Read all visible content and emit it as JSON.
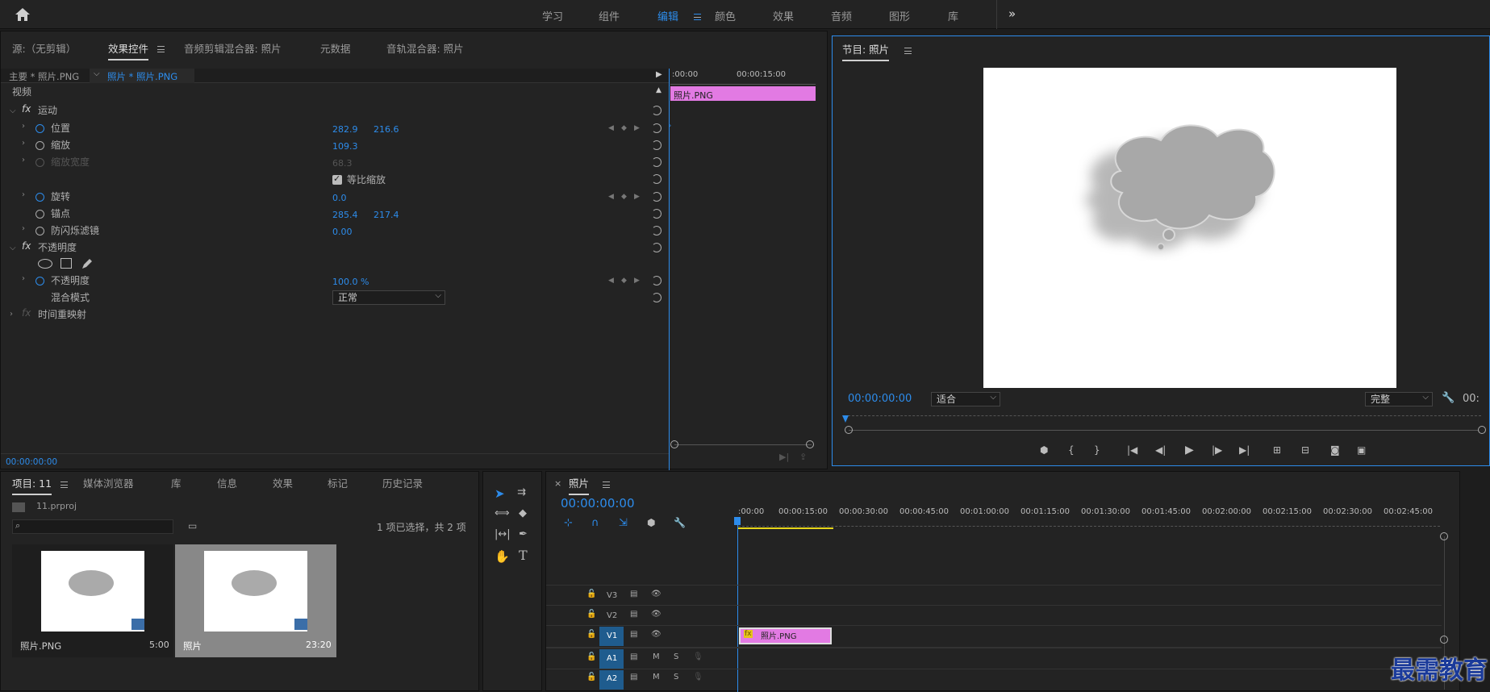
{
  "colors": {
    "accent": "#2d8ceb",
    "clip_pink": "#e27ae3",
    "panel_bg": "#232323",
    "bg": "#1d1d1d"
  },
  "workspaces": [
    "学习",
    "组件",
    "编辑",
    "颜色",
    "效果",
    "音频",
    "图形",
    "库"
  ],
  "workspace_active": "编辑",
  "more_icon": "»",
  "effect_controls": {
    "tabs": [
      "源:（无剪辑）",
      "效果控件",
      "音频剪辑混合器: 照片",
      "元数据",
      "音轨混合器: 照片"
    ],
    "master_clip": "主要 * 照片.PNG",
    "clip": "照片 * 照片.PNG",
    "section_video": "视频",
    "motion": "运动",
    "position_label": "位置",
    "position_x": "282.9",
    "position_y": "216.6",
    "scale_label": "缩放",
    "scale_val": "109.3",
    "scale_width_label": "缩放宽度",
    "scale_width_val": "68.3",
    "uniform_scale": "等比缩放",
    "rotation_label": "旋转",
    "rotation_val": "0.0",
    "anchor_label": "锚点",
    "anchor_x": "285.4",
    "anchor_y": "217.4",
    "flicker_label": "防闪烁滤镜",
    "flicker_val": "0.00",
    "opacity_section": "不透明度",
    "opacity_label": "不透明度",
    "opacity_val": "100.0 %",
    "blend_label": "混合模式",
    "blend_val": "正常",
    "time_remap": "时间重映射",
    "timecode": "00:00:00:00",
    "ruler_start": ":00:00",
    "ruler_mid": "00:00:15:00",
    "clip_bar_label": "照片.PNG",
    "fx_glyph": "fx",
    "keyframe_glyph": "◆"
  },
  "program_monitor": {
    "title": "节目: 照片",
    "timecode": "00:00:00:00",
    "fit": "适合",
    "quality": "完整",
    "timecode_right": "00:"
  },
  "project": {
    "tabs": [
      "项目: 11",
      "媒体浏览器",
      "库",
      "信息",
      "效果",
      "标记",
      "历史记录"
    ],
    "file": "11.prproj",
    "selection": "1 项已选择，共 2 项",
    "items": [
      {
        "name": "照片.PNG",
        "duration": "5:00"
      },
      {
        "name": "照片",
        "duration": "23:20"
      }
    ]
  },
  "timeline": {
    "title": "照片",
    "timecode": "00:00:00:00",
    "ruler": [
      ":00:00",
      "00:00:15:00",
      "00:00:30:00",
      "00:00:45:00",
      "00:01:00:00",
      "00:01:15:00",
      "00:01:30:00",
      "00:01:45:00",
      "00:02:00:00",
      "00:02:15:00",
      "00:02:30:00",
      "00:02:45:00"
    ],
    "tracks": [
      "V3",
      "V2",
      "V1",
      "A1",
      "A2"
    ],
    "track_m": "M",
    "track_s": "S",
    "clip_label": "照片.PNG"
  },
  "watermark": "最需教育"
}
